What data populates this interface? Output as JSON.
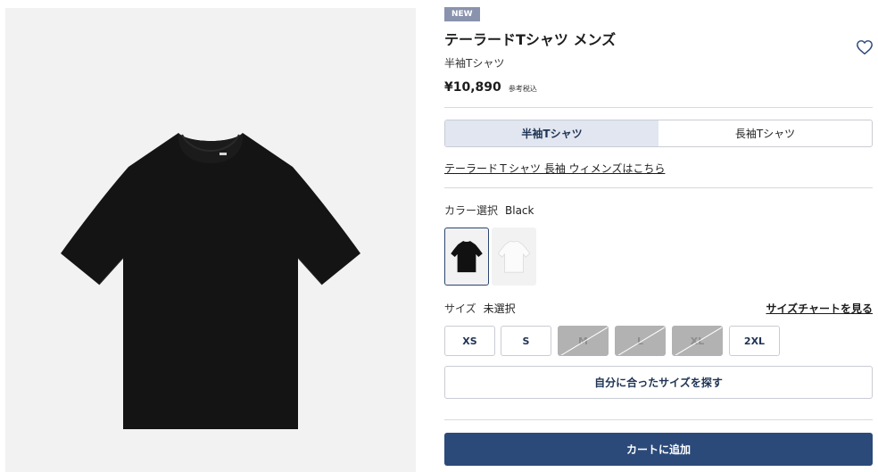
{
  "product": {
    "badge": "NEW",
    "title": "テーラードTシャツ メンズ",
    "subtitle": "半袖Tシャツ",
    "price": "¥10,890",
    "tax_note": "参考税込",
    "favorite_icon": "heart-outline-icon"
  },
  "sleeve_options": [
    {
      "label": "半袖Tシャツ",
      "selected": true
    },
    {
      "label": "長袖Tシャツ",
      "selected": false
    }
  ],
  "women_link": "テーラードＴシャツ 長袖 ウィメンズはこちら",
  "color": {
    "label": "カラー選択",
    "selected": "Black",
    "swatches": [
      {
        "name": "Black",
        "color": "#111111",
        "selected": true
      },
      {
        "name": "White",
        "color": "#f4f4f4",
        "selected": false
      }
    ]
  },
  "size": {
    "label": "サイズ",
    "selected": "未選択",
    "chart_link": "サイズチャートを見る",
    "options": [
      {
        "label": "XS",
        "available": true
      },
      {
        "label": "S",
        "available": true
      },
      {
        "label": "M",
        "available": false
      },
      {
        "label": "L",
        "available": false
      },
      {
        "label": "XL",
        "available": false
      },
      {
        "label": "2XL",
        "available": true
      }
    ]
  },
  "size_finder_label": "自分に合ったサイズを探す",
  "add_to_cart_label": "カートに追加",
  "colors": {
    "accent": "#2b4a7a",
    "selected_tab_bg": "#e1e6f0",
    "badge_bg": "#8a93ad",
    "disabled_size_bg": "#b2b2b2"
  }
}
